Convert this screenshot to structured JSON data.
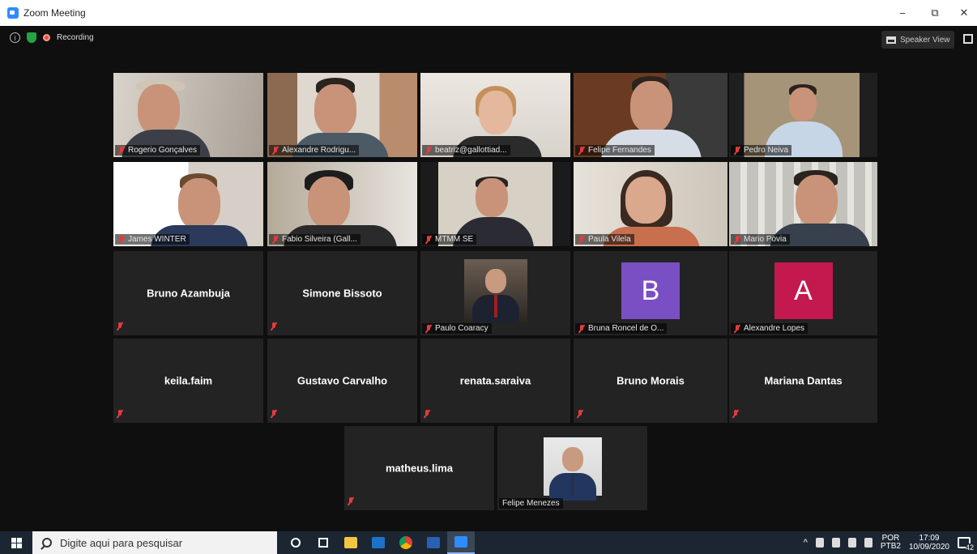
{
  "window": {
    "title": "Zoom Meeting",
    "minimize": "−",
    "restore": "⧉",
    "close": "✕"
  },
  "topbar": {
    "info": "i",
    "recording_label": "Recording",
    "speaker_view_label": "Speaker View"
  },
  "colors": {
    "active_border": "#c7e57a",
    "mute_red": "#e43b3b",
    "tile_bg": "#232323",
    "meeting_bg": "#0f0f0f"
  },
  "participants": [
    {
      "name": "Rogerio Gonçalves",
      "kind": "video"
    },
    {
      "name": "Alexandre Rodrigu...",
      "kind": "video"
    },
    {
      "name": "beatriz@gallottiad...",
      "kind": "video"
    },
    {
      "name": "Felipe Fernandes",
      "kind": "video",
      "active": true
    },
    {
      "name": "Pedro Neiva",
      "kind": "video"
    },
    {
      "name": "James WINTER",
      "kind": "video"
    },
    {
      "name": "Fabio Silveira (Gall...",
      "kind": "video"
    },
    {
      "name": "MTMM SE",
      "kind": "video"
    },
    {
      "name": "Paula Vilela",
      "kind": "video"
    },
    {
      "name": "Mario Povia",
      "kind": "video"
    },
    {
      "name": "Bruno Azambuja",
      "kind": "name"
    },
    {
      "name": "Simone Bissoto",
      "kind": "name"
    },
    {
      "name": "Paulo Coaracy",
      "kind": "photo"
    },
    {
      "name": "Bruna Roncel de O...",
      "kind": "avatar",
      "letter": "B",
      "color": "#7b4fc4"
    },
    {
      "name": "Alexandre Lopes",
      "kind": "avatar",
      "letter": "A",
      "color": "#c3194f"
    },
    {
      "name": "keila.faim",
      "kind": "name"
    },
    {
      "name": "Gustavo Carvalho",
      "kind": "name"
    },
    {
      "name": "renata.saraiva",
      "kind": "name"
    },
    {
      "name": "Bruno Morais",
      "kind": "name"
    },
    {
      "name": "Mariana Dantas",
      "kind": "name"
    },
    {
      "name": "matheus.lima",
      "kind": "name"
    },
    {
      "name": "Felipe Menezes",
      "kind": "photo"
    }
  ],
  "taskbar": {
    "search_placeholder": "Digite aqui para pesquisar",
    "lang_top": "POR",
    "lang_bottom": "PTB2",
    "time": "17:09",
    "date": "10/09/2020",
    "notification_count": "42"
  }
}
